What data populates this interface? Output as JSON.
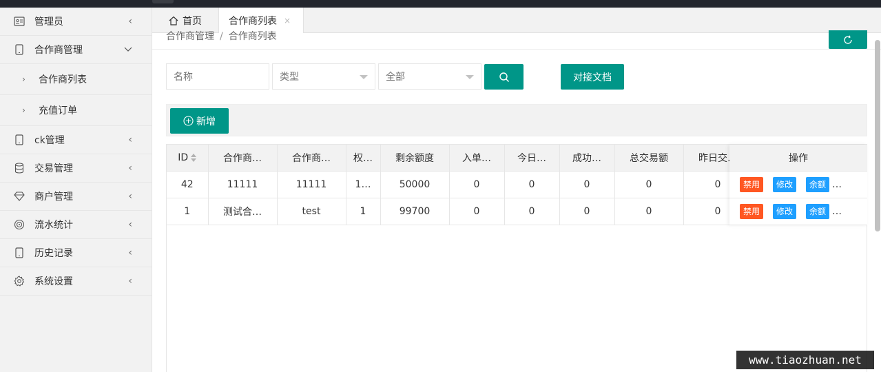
{
  "sidebar": {
    "items": [
      {
        "label": "管理员",
        "icon": "id-card-icon",
        "arrow": "<"
      },
      {
        "label": "合作商管理",
        "icon": "phone-icon",
        "arrow": "v"
      },
      {
        "label": "ck管理",
        "icon": "phone-icon",
        "arrow": "<"
      },
      {
        "label": "交易管理",
        "icon": "database-icon",
        "arrow": "<"
      },
      {
        "label": "商户管理",
        "icon": "diamond-icon",
        "arrow": "<"
      },
      {
        "label": "流水统计",
        "icon": "target-icon",
        "arrow": "<"
      },
      {
        "label": "历史记录",
        "icon": "phone-icon",
        "arrow": "<"
      },
      {
        "label": "系统设置",
        "icon": "gear-icon",
        "arrow": "<"
      }
    ],
    "subitems": [
      {
        "label": "合作商列表"
      },
      {
        "label": "充值订单"
      }
    ]
  },
  "tabs": {
    "home": "首页",
    "active": "合作商列表",
    "close": "×"
  },
  "breadcrumb": {
    "parent": "合作商管理",
    "sep": "/",
    "current": "合作商列表"
  },
  "search": {
    "name_placeholder": "名称",
    "type_value": "类型",
    "status_value": "全部",
    "doc_button": "对接文档"
  },
  "toolbar": {
    "add_label": "新增"
  },
  "table": {
    "headers": [
      "ID",
      "合作商…",
      "合作商…",
      "权…",
      "剩余额度",
      "入单…",
      "今日…",
      "成功…",
      "总交易额",
      "昨日交…"
    ],
    "op_header": "操作",
    "rows": [
      {
        "cells": [
          "42",
          "11111",
          "11111",
          "1…",
          "50000",
          "0",
          "0",
          "0",
          "0",
          "0"
        ]
      },
      {
        "cells": [
          "1",
          "测试合…",
          "test",
          "1",
          "99700",
          "0",
          "0",
          "0",
          "0",
          "0"
        ]
      }
    ],
    "actions": {
      "disable": "禁用",
      "edit": "修改",
      "balance": "余额",
      "more": "…"
    }
  },
  "colors": {
    "primary": "#009688",
    "danger": "#ff5722",
    "info": "#1e9fff"
  },
  "watermark": "www.tiaozhuan.net"
}
